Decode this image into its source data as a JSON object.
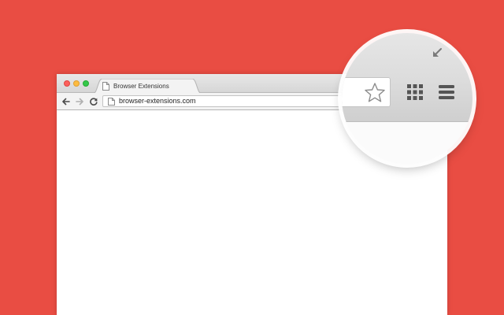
{
  "background_color": "#e94d43",
  "tab": {
    "title": "Browser Extensions",
    "icon": "page-icon"
  },
  "window_controls": {
    "close_color": "#fc605c",
    "minimize_color": "#fdbc40",
    "maximize_color": "#34c84a"
  },
  "toolbar": {
    "back_icon": "arrow-left-icon",
    "forward_icon": "arrow-right-icon",
    "reload_icon": "reload-icon"
  },
  "omnibox": {
    "url": "browser-extensions.com",
    "icon": "page-icon"
  },
  "magnifier": {
    "icons": [
      "star-icon",
      "apps-grid-icon",
      "menu-icon"
    ]
  },
  "corner_icon": "resize-arrow-icon"
}
